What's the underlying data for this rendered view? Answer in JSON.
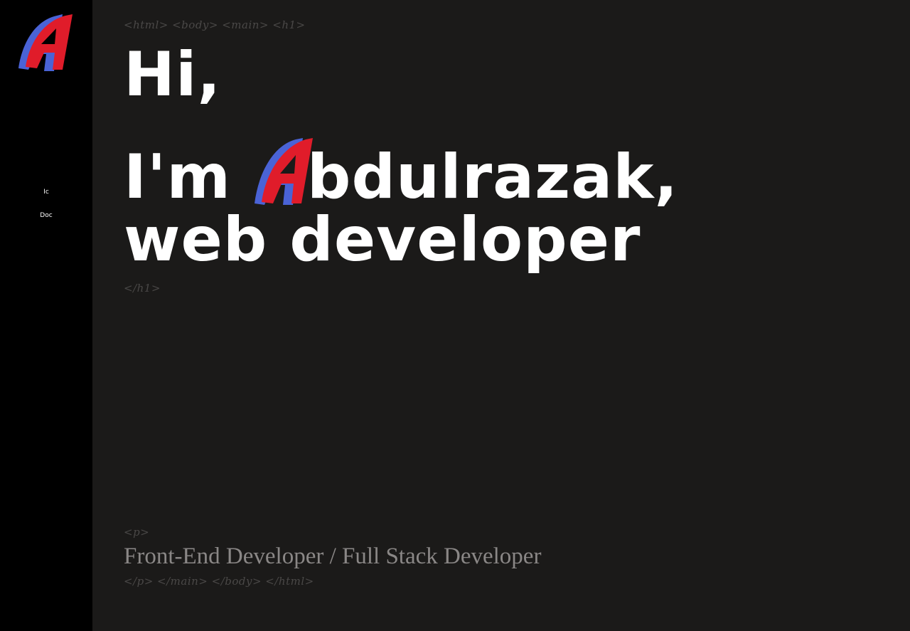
{
  "sidebar": {
    "logo_letter": "A",
    "nav_items": [
      {
        "label": "Ic"
      },
      {
        "label": "Doc"
      }
    ]
  },
  "main": {
    "open_tags": "<html> <body> <main> <h1>",
    "heading_line1": "Hi,",
    "heading_line2_prefix": "I'm ",
    "heading_name_rest": "bdulrazak,",
    "heading_line3": "web developer",
    "close_h1_tag": "</h1>",
    "open_p_tag": "<p>",
    "subtitle": "Front-End Developer / Full Stack Developer",
    "close_tags": "</p> </main> </body> </html>"
  },
  "colors": {
    "sidebar_bg": "#000000",
    "main_bg": "#1b1a19",
    "logo_blue": "#4a63d6",
    "logo_red": "#e01c2a",
    "heading": "#ffffff",
    "tag": "#4a4847",
    "subtitle": "#8a8786"
  }
}
